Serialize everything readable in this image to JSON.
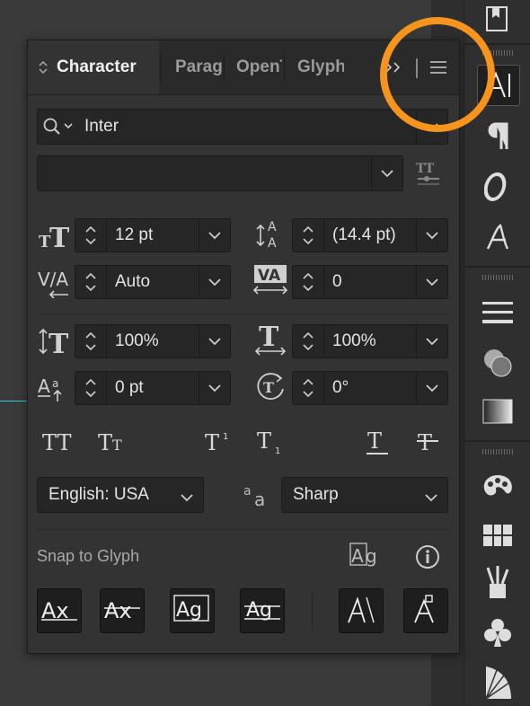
{
  "panel": {
    "tabs": [
      {
        "label": "Character",
        "active": true
      },
      {
        "label": "Paragraph",
        "active": false
      },
      {
        "label": "OpenType",
        "active": false
      },
      {
        "label": "Glyphs",
        "active": false
      }
    ],
    "overflow_icon": "double-chevron-right-icon",
    "menu_icon": "hamburger-menu-icon"
  },
  "font": {
    "family": "Inter",
    "style": ""
  },
  "metrics": {
    "font_size": "12 pt",
    "leading": "(14.4 pt)",
    "kerning": "Auto",
    "tracking": "0",
    "vertical_scale": "100%",
    "horizontal_scale": "100%",
    "baseline_shift": "0 pt",
    "rotation": "0°"
  },
  "language": "English: USA",
  "anti_alias": "Sharp",
  "snap": {
    "label": "Snap to Glyph"
  },
  "colors": {
    "highlight_circle": "#f7941d",
    "panel_bg": "#333333",
    "field_bg": "#262626",
    "guide_line": "#2fc7d6"
  }
}
